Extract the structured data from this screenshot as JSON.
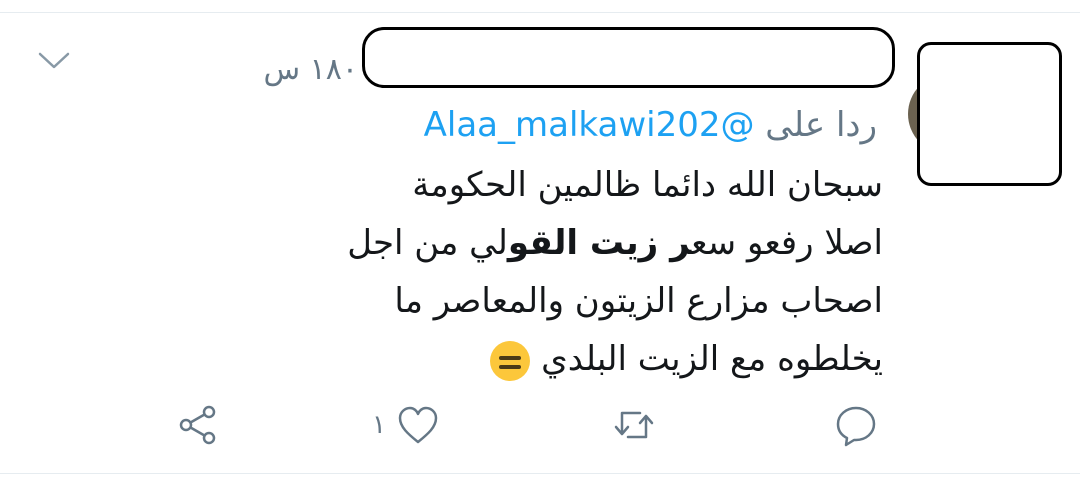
{
  "tweet": {
    "time": "١٨٠ س",
    "reply_prefix": "ردا على",
    "reply_handle": "@Alaa_malkawi202",
    "line1": "سبحان الله دائما ظالمين الحكومة",
    "line2_part1": "اصلا رفعو  سع",
    "line2_bold": "ر زيت القو",
    "line2_part2": "لي من اجل",
    "line3": "اصحاب مزارع الزيتون والمعاصر ما",
    "line4": "يخلطوه مع الزيت البلدي",
    "emoji": "expressionless-face-emoji"
  },
  "actions": {
    "reply_icon": "reply-icon",
    "retweet_icon": "retweet-icon",
    "like_icon": "heart-icon",
    "like_count": "١",
    "share_icon": "share-icon"
  },
  "colors": {
    "secondary_text": "#657786",
    "link": "#1da1f2",
    "text": "#14171a",
    "emoji": "#fcc73b"
  }
}
